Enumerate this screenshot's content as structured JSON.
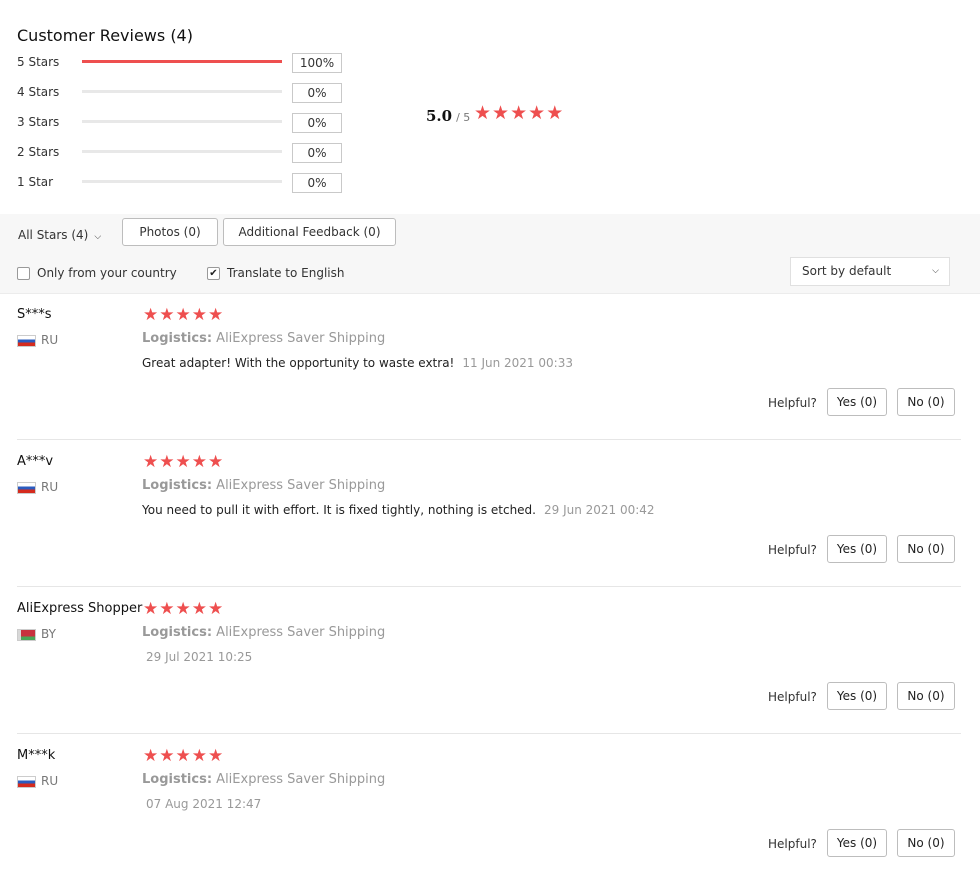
{
  "title": "Customer Reviews (4)",
  "breakdown": [
    {
      "label": "5 Stars",
      "percent_text": "100%",
      "fill": 1.0
    },
    {
      "label": "4 Stars",
      "percent_text": "0%",
      "fill": 0
    },
    {
      "label": "3 Stars",
      "percent_text": "0%",
      "fill": 0
    },
    {
      "label": "2 Stars",
      "percent_text": "0%",
      "fill": 0
    },
    {
      "label": "1 Star",
      "percent_text": "0%",
      "fill": 0
    }
  ],
  "summary": {
    "score": "5.0",
    "max": "/ 5",
    "stars": 5
  },
  "filters": {
    "all_stars": "All Stars (4)",
    "photos": "Photos (0)",
    "additional": "Additional Feedback (0)",
    "only_country": "Only from your country",
    "only_country_checked": false,
    "translate": "Translate to English",
    "translate_checked": true,
    "sort": "Sort by default"
  },
  "helpful_label": "Helpful?",
  "logistics_label": "Logistics:",
  "reviews": [
    {
      "name": "S***s",
      "country": "RU",
      "flag": "ru",
      "stars": 5,
      "logistics": "AliExpress Saver Shipping",
      "text": "Great adapter! With the opportunity to waste extra!",
      "date": "11 Jun 2021 00:33",
      "yes": "Yes (0)",
      "no": "No (0)"
    },
    {
      "name": "A***v",
      "country": "RU",
      "flag": "ru",
      "stars": 5,
      "logistics": "AliExpress Saver Shipping",
      "text": "You need to pull it with effort. It is fixed tightly, nothing is etched.",
      "date": "29 Jun 2021 00:42",
      "yes": "Yes (0)",
      "no": "No (0)"
    },
    {
      "name": "AliExpress Shopper",
      "country": "BY",
      "flag": "by",
      "stars": 5,
      "logistics": "AliExpress Saver Shipping",
      "text": "",
      "date": "29 Jul 2021 10:25",
      "yes": "Yes (0)",
      "no": "No (0)"
    },
    {
      "name": "M***k",
      "country": "RU",
      "flag": "ru",
      "stars": 5,
      "logistics": "AliExpress Saver Shipping",
      "text": "",
      "date": "07 Aug 2021 12:47",
      "yes": "Yes (0)",
      "no": "No (0)"
    }
  ]
}
